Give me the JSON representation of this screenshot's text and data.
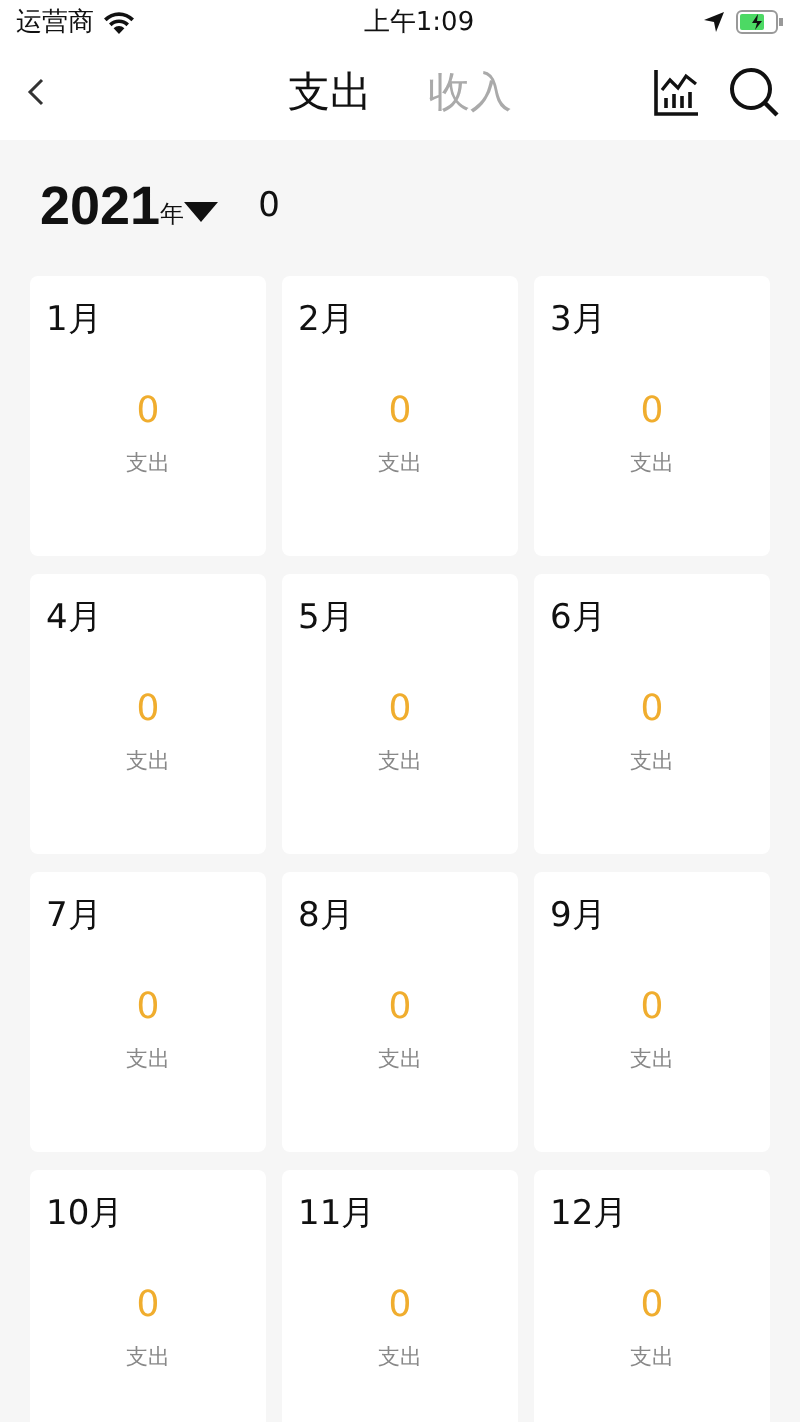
{
  "status_bar": {
    "carrier": "运营商",
    "time": "上午1:09"
  },
  "nav": {
    "tabs": [
      {
        "label": "支出",
        "selected": true
      },
      {
        "label": "收入",
        "selected": false
      }
    ]
  },
  "year_bar": {
    "year": "2021",
    "unit": "年",
    "total": "0"
  },
  "months": [
    {
      "month": "1月",
      "amount": "0",
      "label": "支出"
    },
    {
      "month": "2月",
      "amount": "0",
      "label": "支出"
    },
    {
      "month": "3月",
      "amount": "0",
      "label": "支出"
    },
    {
      "month": "4月",
      "amount": "0",
      "label": "支出"
    },
    {
      "month": "5月",
      "amount": "0",
      "label": "支出"
    },
    {
      "month": "6月",
      "amount": "0",
      "label": "支出"
    },
    {
      "month": "7月",
      "amount": "0",
      "label": "支出"
    },
    {
      "month": "8月",
      "amount": "0",
      "label": "支出"
    },
    {
      "month": "9月",
      "amount": "0",
      "label": "支出"
    },
    {
      "month": "10月",
      "amount": "0",
      "label": "支出"
    },
    {
      "month": "11月",
      "amount": "0",
      "label": "支出"
    },
    {
      "month": "12月",
      "amount": "0",
      "label": "支出"
    }
  ]
}
